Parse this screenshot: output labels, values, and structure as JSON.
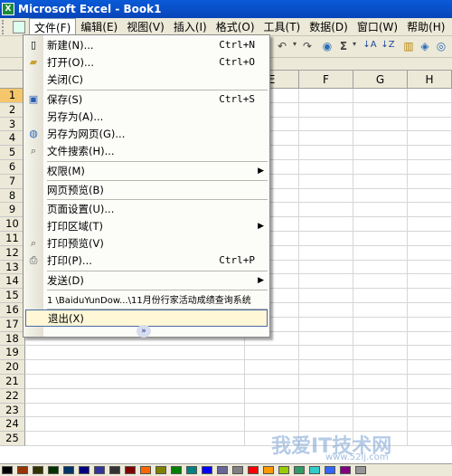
{
  "window": {
    "title": "Microsoft Excel - Book1"
  },
  "menubar": {
    "items": [
      {
        "label": "文件(F)"
      },
      {
        "label": "编辑(E)"
      },
      {
        "label": "视图(V)"
      },
      {
        "label": "插入(I)"
      },
      {
        "label": "格式(O)"
      },
      {
        "label": "工具(T)"
      },
      {
        "label": "数据(D)"
      },
      {
        "label": "窗口(W)"
      },
      {
        "label": "帮助(H)"
      }
    ]
  },
  "grid": {
    "columns": [
      "E",
      "F",
      "G",
      "H"
    ],
    "rows": [
      "1",
      "2",
      "3",
      "4",
      "5",
      "6",
      "7",
      "8",
      "9",
      "10",
      "11",
      "12",
      "13",
      "14",
      "15",
      "16",
      "17",
      "18",
      "19",
      "20",
      "21",
      "22",
      "23",
      "24",
      "25"
    ]
  },
  "file_menu": {
    "items": [
      {
        "label": "新建(N)...",
        "shortcut": "Ctrl+N",
        "icon": "new-doc-icon"
      },
      {
        "label": "打开(O)...",
        "shortcut": "Ctrl+O",
        "icon": "open-folder-icon"
      },
      {
        "label": "关闭(C)",
        "shortcut": "",
        "icon": ""
      },
      {
        "label": "保存(S)",
        "shortcut": "Ctrl+S",
        "icon": "save-icon"
      },
      {
        "label": "另存为(A)...",
        "shortcut": "",
        "icon": ""
      },
      {
        "label": "另存为网页(G)...",
        "shortcut": "",
        "icon": "save-web-icon"
      },
      {
        "label": "文件搜索(H)...",
        "shortcut": "",
        "icon": "file-search-icon"
      },
      {
        "label": "权限(M)",
        "shortcut": "",
        "icon": "",
        "submenu": true
      },
      {
        "label": "网页预览(B)",
        "shortcut": "",
        "icon": ""
      },
      {
        "label": "页面设置(U)...",
        "shortcut": "",
        "icon": ""
      },
      {
        "label": "打印区域(T)",
        "shortcut": "",
        "icon": "",
        "submenu": true
      },
      {
        "label": "打印预览(V)",
        "shortcut": "",
        "icon": "print-preview-icon"
      },
      {
        "label": "打印(P)...",
        "shortcut": "Ctrl+P",
        "icon": "print-icon"
      },
      {
        "label": "发送(D)",
        "shortcut": "",
        "icon": "",
        "submenu": true
      },
      {
        "label": "1 \\BaiduYunDow...\\11月份行家活动成绩查询系统",
        "shortcut": "",
        "icon": ""
      },
      {
        "label": "退出(X)",
        "shortcut": "",
        "icon": ""
      }
    ],
    "expand_glyph": "»"
  },
  "watermark": {
    "main": "我爱IT技术网",
    "sub": "www.52ij.com"
  },
  "palette_colors": [
    "#000000",
    "#993300",
    "#333300",
    "#003300",
    "#003366",
    "#000080",
    "#333399",
    "#333333",
    "#800000",
    "#ff6600",
    "#808000",
    "#008000",
    "#008080",
    "#0000ff",
    "#666699",
    "#808080",
    "#ff0000",
    "#ff9900",
    "#99cc00",
    "#339966",
    "#33cccc",
    "#3366ff",
    "#800080",
    "#969696"
  ]
}
